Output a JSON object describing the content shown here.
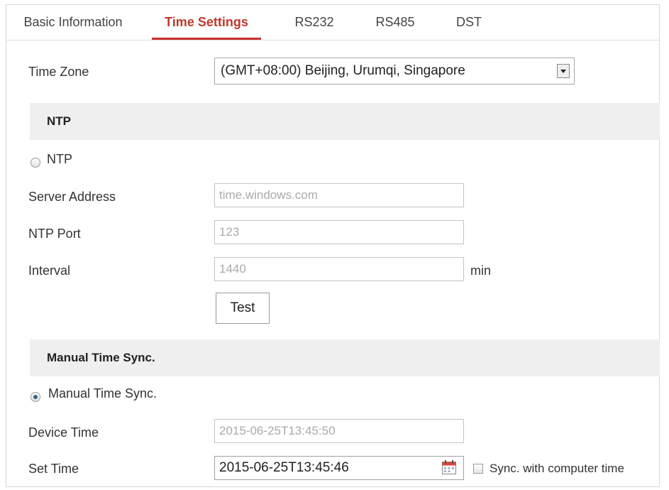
{
  "tabs": [
    {
      "label": "Basic Information",
      "active": false
    },
    {
      "label": "Time Settings",
      "active": true
    },
    {
      "label": "RS232",
      "active": false
    },
    {
      "label": "RS485",
      "active": false
    },
    {
      "label": "DST",
      "active": false
    }
  ],
  "time_zone": {
    "label": "Time Zone",
    "value": "(GMT+08:00) Beijing, Urumqi, Singapore"
  },
  "ntp": {
    "section_title": "NTP",
    "radio_label": "NTP",
    "radio_selected": false,
    "server_address": {
      "label": "Server Address",
      "value": "time.windows.com"
    },
    "port": {
      "label": "NTP Port",
      "value": "123"
    },
    "interval": {
      "label": "Interval",
      "value": "1440",
      "unit": "min"
    },
    "test_button": "Test"
  },
  "manual": {
    "section_title": "Manual Time Sync.",
    "radio_label": "Manual Time Sync.",
    "radio_selected": true,
    "device_time": {
      "label": "Device Time",
      "value": "2015-06-25T13:45:50"
    },
    "set_time": {
      "label": "Set Time",
      "value": "2015-06-25T13:45:46"
    },
    "sync_label": "Sync. with computer time",
    "sync_checked": false
  },
  "icons": {
    "calendar": "calendar-icon",
    "dropdown": "chevron-down-icon"
  },
  "colors": {
    "accent": "#c9302c",
    "section_bg": "#efefef"
  }
}
